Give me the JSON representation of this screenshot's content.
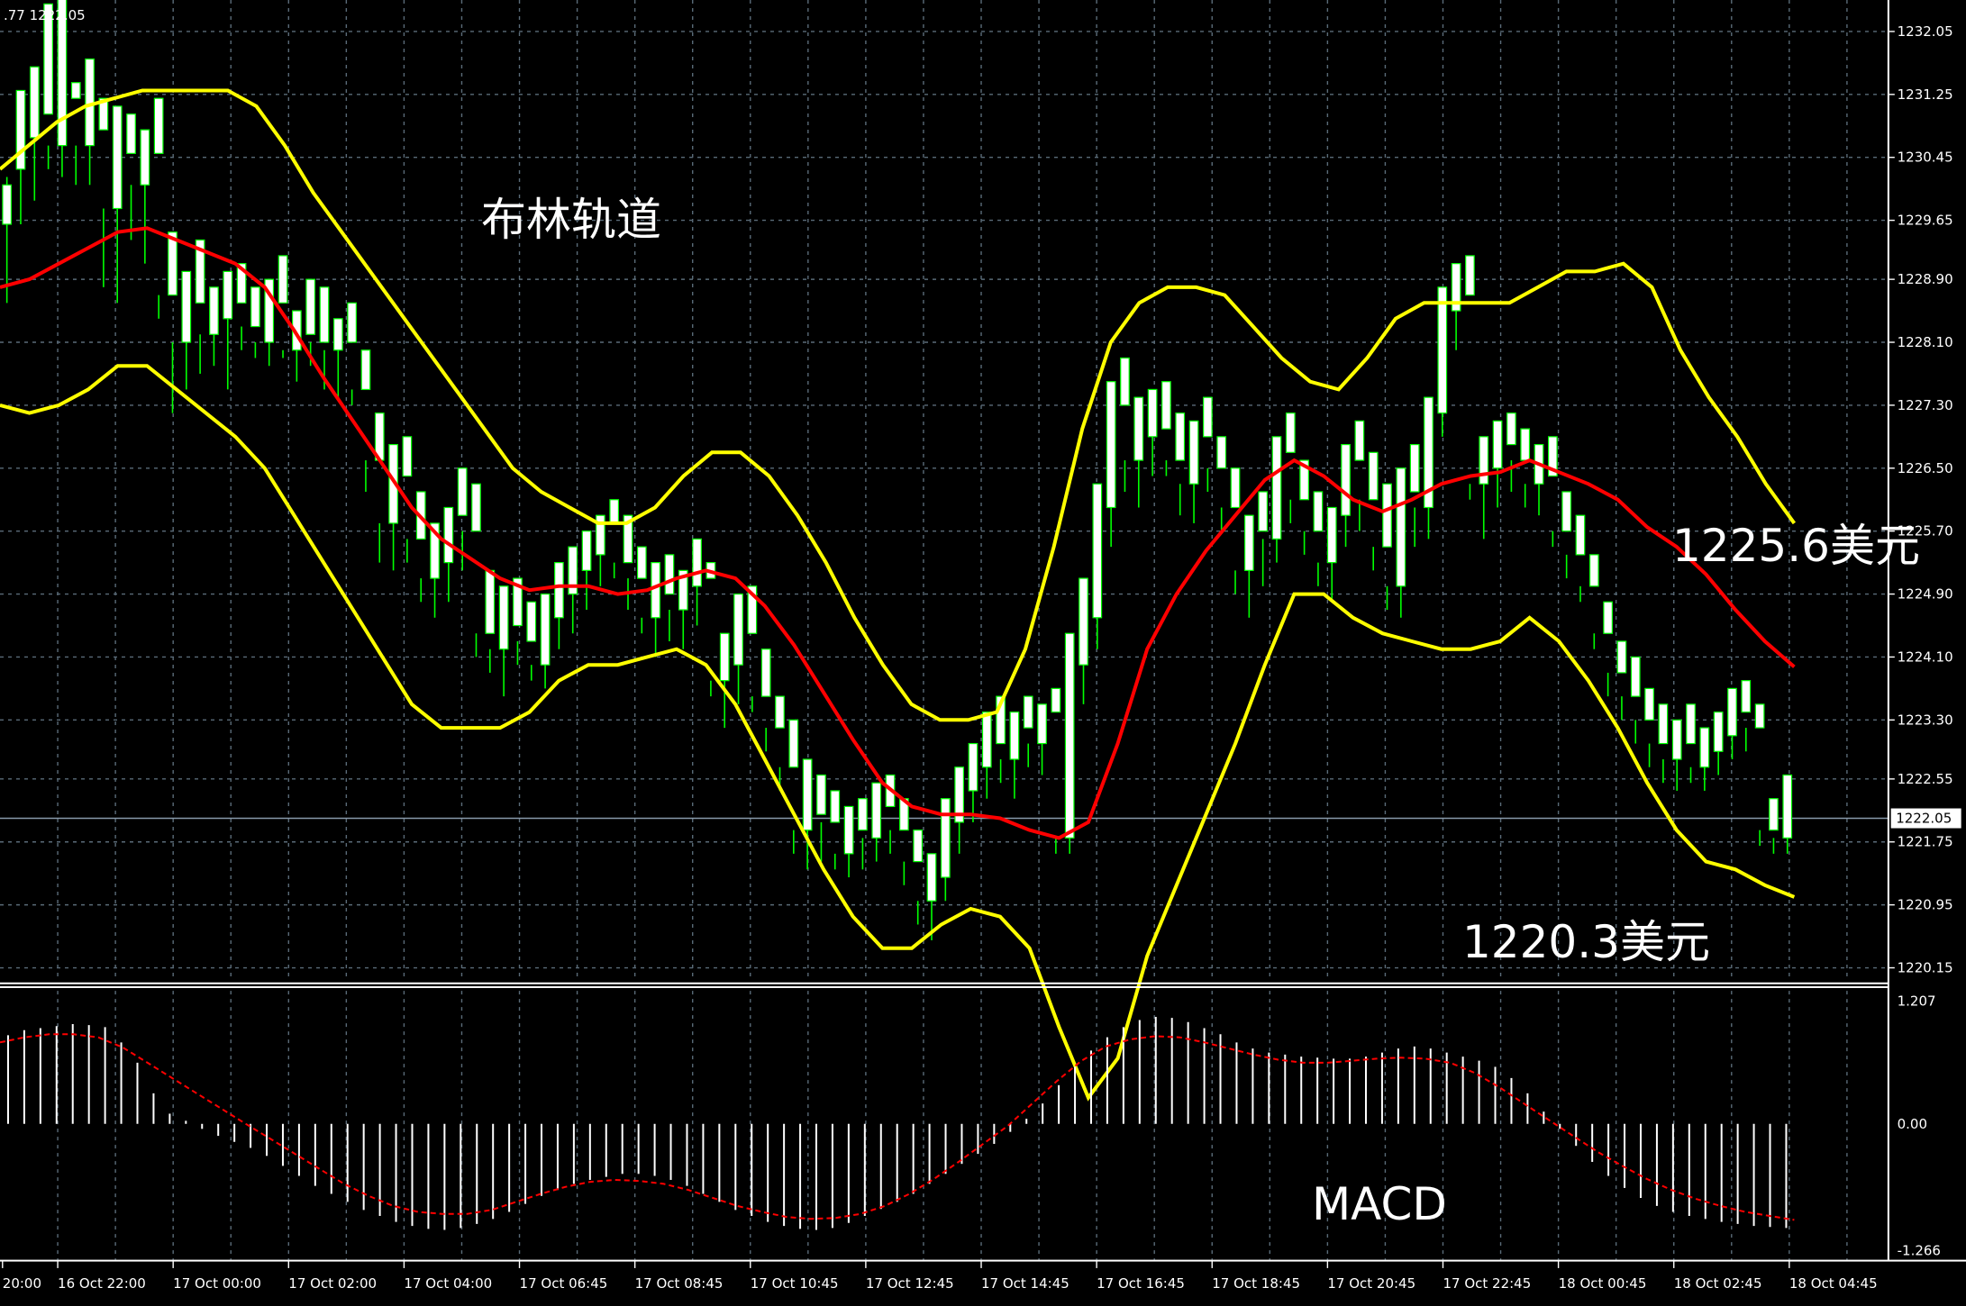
{
  "header": {
    "text": ".77 1222.05"
  },
  "price_axis": {
    "ticks": [
      "1232.05",
      "1231.25",
      "1230.45",
      "1229.65",
      "1228.90",
      "1228.10",
      "1227.30",
      "1226.50",
      "1225.70",
      "1224.90",
      "1224.10",
      "1223.30",
      "1222.55",
      "1221.75",
      "1220.95",
      "1220.15"
    ],
    "current_label": "1222.05",
    "current_value": 1222.05
  },
  "macd_axis": {
    "ticks": [
      "1.207",
      "0.00",
      "-1.266"
    ]
  },
  "time_axis": {
    "labels": [
      "20:00",
      "16 Oct 22:00",
      "17 Oct 00:00",
      "17 Oct 02:00",
      "17 Oct 04:00",
      "17 Oct 06:45",
      "17 Oct 08:45",
      "17 Oct 10:45",
      "17 Oct 12:45",
      "17 Oct 14:45",
      "17 Oct 16:45",
      "17 Oct 18:45",
      "17 Oct 20:45",
      "17 Oct 22:45",
      "18 Oct 00:45",
      "18 Oct 02:45",
      "18 Oct 04:45"
    ]
  },
  "annotations": {
    "bollinger": "布林轨道",
    "upper_target": "1225.6美元",
    "lower_target": "1220.3美元",
    "macd": "MACD"
  },
  "colors": {
    "background": "#000000",
    "grid": "#5a6b78",
    "bull_candle": "#ffffff",
    "bear_candle": "#000000",
    "wick": "#00ff00",
    "bollinger_band": "#ffff00",
    "moving_average": "#ff0000",
    "macd_hist": "#ffffff",
    "macd_signal": "#ff0000",
    "current_line": "#8899aa"
  },
  "chart_data": [
    {
      "type": "candlestick",
      "instrument": "XAUUSD",
      "ylim": [
        1220.0,
        1232.45
      ],
      "grid": true,
      "candles": [
        [
          1229.6,
          1230.1,
          1228.6,
          1230.2
        ],
        [
          1230.3,
          1231.3,
          1229.6,
          1230.7
        ],
        [
          1230.7,
          1231.6,
          1229.9,
          1231.0
        ],
        [
          1231.0,
          1232.4,
          1230.3,
          1230.6
        ],
        [
          1230.6,
          1232.5,
          1230.2,
          1231.2
        ],
        [
          1231.2,
          1231.4,
          1230.1,
          1230.6
        ],
        [
          1230.6,
          1231.7,
          1230.1,
          1230.8
        ],
        [
          1230.8,
          1231.2,
          1228.8,
          1229.8
        ],
        [
          1229.8,
          1231.1,
          1228.6,
          1230.5
        ],
        [
          1230.5,
          1231.0,
          1229.4,
          1230.1
        ],
        [
          1230.1,
          1230.8,
          1229.1,
          1230.5
        ],
        [
          1230.5,
          1231.2,
          1228.4,
          1228.7
        ],
        [
          1228.7,
          1229.5,
          1227.2,
          1228.1
        ],
        [
          1228.1,
          1229.0,
          1227.5,
          1228.6
        ],
        [
          1228.6,
          1229.4,
          1227.7,
          1228.2
        ],
        [
          1228.2,
          1228.8,
          1227.8,
          1228.4
        ],
        [
          1228.4,
          1229.0,
          1227.5,
          1228.6
        ],
        [
          1228.6,
          1229.1,
          1228.0,
          1228.3
        ],
        [
          1228.3,
          1228.8,
          1227.9,
          1228.1
        ],
        [
          1228.1,
          1228.9,
          1227.8,
          1228.6
        ],
        [
          1228.6,
          1229.2,
          1227.9,
          1228.0
        ],
        [
          1228.0,
          1228.5,
          1227.6,
          1228.2
        ],
        [
          1228.2,
          1228.9,
          1227.8,
          1228.1
        ],
        [
          1228.1,
          1228.8,
          1227.5,
          1228.0
        ],
        [
          1228.0,
          1228.4,
          1227.4,
          1228.1
        ],
        [
          1228.1,
          1228.6,
          1227.3,
          1227.5
        ],
        [
          1227.5,
          1228.0,
          1226.2,
          1226.6
        ],
        [
          1226.6,
          1227.2,
          1225.3,
          1225.8
        ],
        [
          1225.8,
          1226.8,
          1225.2,
          1226.4
        ],
        [
          1226.4,
          1226.9,
          1225.3,
          1225.6
        ],
        [
          1225.6,
          1226.2,
          1224.8,
          1225.1
        ],
        [
          1225.1,
          1225.8,
          1224.6,
          1225.3
        ],
        [
          1225.3,
          1226.0,
          1224.8,
          1225.9
        ],
        [
          1225.9,
          1226.5,
          1225.2,
          1225.7
        ],
        [
          1225.7,
          1226.3,
          1224.1,
          1224.4
        ],
        [
          1224.4,
          1225.2,
          1223.9,
          1224.2
        ],
        [
          1224.2,
          1225.0,
          1223.6,
          1224.5
        ],
        [
          1224.5,
          1225.1,
          1224.0,
          1224.3
        ],
        [
          1224.3,
          1224.8,
          1223.8,
          1224.0
        ],
        [
          1224.0,
          1224.9,
          1223.7,
          1224.6
        ],
        [
          1224.6,
          1225.3,
          1224.2,
          1224.9
        ],
        [
          1224.9,
          1225.5,
          1224.4,
          1225.2
        ],
        [
          1225.2,
          1225.7,
          1224.7,
          1225.4
        ],
        [
          1225.4,
          1225.9,
          1225.0,
          1225.8
        ],
        [
          1225.8,
          1226.1,
          1225.1,
          1225.3
        ],
        [
          1225.3,
          1225.9,
          1224.7,
          1225.1
        ],
        [
          1225.1,
          1225.5,
          1224.4,
          1224.6
        ],
        [
          1224.6,
          1225.3,
          1224.1,
          1224.9
        ],
        [
          1224.9,
          1225.4,
          1224.3,
          1224.7
        ],
        [
          1224.7,
          1225.2,
          1224.2,
          1225.0
        ],
        [
          1225.0,
          1225.6,
          1224.5,
          1225.1
        ],
        [
          1225.1,
          1225.3,
          1223.6,
          1223.8
        ],
        [
          1223.8,
          1224.4,
          1223.2,
          1224.0
        ],
        [
          1224.0,
          1224.9,
          1223.5,
          1224.4
        ],
        [
          1224.4,
          1225.0,
          1223.4,
          1223.6
        ],
        [
          1223.6,
          1224.2,
          1222.9,
          1223.2
        ],
        [
          1223.2,
          1223.6,
          1222.4,
          1222.7
        ],
        [
          1222.7,
          1223.3,
          1221.6,
          1221.9
        ],
        [
          1221.9,
          1222.8,
          1221.4,
          1222.1
        ],
        [
          1222.1,
          1222.6,
          1221.5,
          1222.0
        ],
        [
          1222.0,
          1222.4,
          1221.4,
          1221.6
        ],
        [
          1221.6,
          1222.2,
          1221.3,
          1221.9
        ],
        [
          1221.9,
          1222.3,
          1221.4,
          1221.8
        ],
        [
          1221.8,
          1222.5,
          1221.5,
          1222.2
        ],
        [
          1222.2,
          1222.6,
          1221.6,
          1221.9
        ],
        [
          1221.9,
          1222.3,
          1221.2,
          1221.5
        ],
        [
          1221.5,
          1221.9,
          1220.7,
          1221.0
        ],
        [
          1221.0,
          1221.6,
          1220.5,
          1221.3
        ],
        [
          1221.3,
          1222.3,
          1221.0,
          1222.0
        ],
        [
          1222.0,
          1222.7,
          1221.6,
          1222.4
        ],
        [
          1222.4,
          1223.0,
          1222.0,
          1222.7
        ],
        [
          1222.7,
          1223.4,
          1222.3,
          1223.0
        ],
        [
          1223.0,
          1223.6,
          1222.5,
          1222.8
        ],
        [
          1222.8,
          1223.4,
          1222.3,
          1223.2
        ],
        [
          1223.2,
          1223.6,
          1222.7,
          1223.0
        ],
        [
          1223.0,
          1223.5,
          1222.6,
          1223.4
        ],
        [
          1223.4,
          1223.7,
          1221.6,
          1221.8
        ],
        [
          1221.8,
          1224.4,
          1221.6,
          1224.0
        ],
        [
          1224.0,
          1225.1,
          1223.5,
          1224.6
        ],
        [
          1224.6,
          1226.3,
          1224.2,
          1226.0
        ],
        [
          1226.0,
          1227.6,
          1225.5,
          1227.3
        ],
        [
          1227.3,
          1227.9,
          1226.2,
          1226.6
        ],
        [
          1226.6,
          1227.4,
          1226.0,
          1226.9
        ],
        [
          1226.9,
          1227.5,
          1226.4,
          1227.0
        ],
        [
          1227.0,
          1227.6,
          1226.4,
          1226.6
        ],
        [
          1226.6,
          1227.2,
          1225.9,
          1226.3
        ],
        [
          1226.3,
          1227.1,
          1225.8,
          1226.9
        ],
        [
          1226.9,
          1227.4,
          1226.2,
          1226.5
        ],
        [
          1226.5,
          1226.9,
          1225.7,
          1226.0
        ],
        [
          1226.0,
          1226.5,
          1224.9,
          1225.2
        ],
        [
          1225.2,
          1225.9,
          1224.6,
          1225.7
        ],
        [
          1225.7,
          1226.2,
          1225.0,
          1225.6
        ],
        [
          1225.6,
          1226.9,
          1225.3,
          1226.7
        ],
        [
          1226.7,
          1227.2,
          1225.8,
          1226.1
        ],
        [
          1226.1,
          1226.6,
          1225.4,
          1225.7
        ],
        [
          1225.7,
          1226.2,
          1225.0,
          1225.3
        ],
        [
          1225.3,
          1226.0,
          1224.8,
          1225.9
        ],
        [
          1225.9,
          1226.8,
          1225.5,
          1226.6
        ],
        [
          1226.6,
          1227.1,
          1225.7,
          1226.1
        ],
        [
          1226.1,
          1226.7,
          1225.2,
          1225.5
        ],
        [
          1225.5,
          1226.3,
          1224.7,
          1225.0
        ],
        [
          1225.0,
          1226.5,
          1224.6,
          1226.2
        ],
        [
          1226.2,
          1226.8,
          1225.5,
          1226.0
        ],
        [
          1226.0,
          1227.4,
          1225.6,
          1227.2
        ],
        [
          1227.2,
          1228.8,
          1226.9,
          1228.5
        ],
        [
          1228.5,
          1229.1,
          1228.0,
          1228.7
        ],
        [
          1228.7,
          1229.2,
          1226.1,
          1226.3
        ],
        [
          1226.3,
          1226.9,
          1225.6,
          1226.5
        ],
        [
          1226.5,
          1227.1,
          1226.0,
          1226.8
        ],
        [
          1226.8,
          1227.2,
          1226.2,
          1226.6
        ],
        [
          1226.6,
          1227.0,
          1226.0,
          1226.3
        ],
        [
          1226.3,
          1226.8,
          1225.9,
          1226.4
        ],
        [
          1226.4,
          1226.9,
          1225.5,
          1225.7
        ],
        [
          1225.7,
          1226.2,
          1225.1,
          1225.4
        ],
        [
          1225.4,
          1225.9,
          1224.8,
          1225.0
        ],
        [
          1225.0,
          1225.4,
          1224.2,
          1224.4
        ],
        [
          1224.4,
          1224.8,
          1223.6,
          1223.9
        ],
        [
          1223.9,
          1224.3,
          1223.3,
          1223.6
        ],
        [
          1223.6,
          1224.1,
          1223.0,
          1223.3
        ],
        [
          1223.3,
          1223.7,
          1222.7,
          1223.0
        ],
        [
          1223.0,
          1223.5,
          1222.5,
          1222.8
        ],
        [
          1222.8,
          1223.3,
          1222.4,
          1223.0
        ],
        [
          1223.0,
          1223.5,
          1222.5,
          1222.7
        ],
        [
          1222.7,
          1223.2,
          1222.4,
          1222.9
        ],
        [
          1222.9,
          1223.4,
          1222.6,
          1223.1
        ],
        [
          1223.1,
          1223.7,
          1222.8,
          1223.4
        ],
        [
          1223.4,
          1223.8,
          1222.9,
          1223.2
        ],
        [
          1223.2,
          1223.5,
          1221.7,
          1221.9
        ],
        [
          1221.9,
          1222.3,
          1221.6,
          1221.8
        ],
        [
          1221.8,
          1222.6,
          1221.6,
          1222.05
        ]
      ],
      "bollinger_upper": [
        1230.3,
        1230.6,
        1230.9,
        1231.1,
        1231.2,
        1231.3,
        1231.3,
        1231.3,
        1231.3,
        1231.1,
        1230.6,
        1230.0,
        1229.5,
        1229.0,
        1228.5,
        1228.0,
        1227.5,
        1227.0,
        1226.5,
        1226.2,
        1226.0,
        1225.8,
        1225.8,
        1226.0,
        1226.4,
        1226.7,
        1226.7,
        1226.4,
        1225.9,
        1225.3,
        1224.6,
        1224.0,
        1223.5,
        1223.3,
        1223.3,
        1223.4,
        1224.2,
        1225.5,
        1227.0,
        1228.1,
        1228.6,
        1228.8,
        1228.8,
        1228.7,
        1228.3,
        1227.9,
        1227.6,
        1227.5,
        1227.9,
        1228.4,
        1228.6,
        1228.6,
        1228.6,
        1228.6,
        1228.8,
        1229.0,
        1229.0,
        1229.1,
        1228.8,
        1228.0,
        1227.4,
        1226.9,
        1226.3,
        1225.8
      ],
      "bollinger_lower": [
        1227.3,
        1227.2,
        1227.3,
        1227.5,
        1227.8,
        1227.8,
        1227.5,
        1227.2,
        1226.9,
        1226.5,
        1225.9,
        1225.3,
        1224.7,
        1224.1,
        1223.5,
        1223.2,
        1223.2,
        1223.2,
        1223.4,
        1223.8,
        1224.0,
        1224.0,
        1224.1,
        1224.2,
        1224.0,
        1223.5,
        1222.8,
        1222.1,
        1221.4,
        1220.8,
        1220.4,
        1220.4,
        1220.7,
        1220.9,
        1220.8,
        1220.4,
        1219.4,
        1218.5,
        1219.0,
        1220.3,
        1221.2,
        1222.1,
        1223.0,
        1224.0,
        1224.9,
        1224.9,
        1224.6,
        1224.4,
        1224.3,
        1224.2,
        1224.2,
        1224.3,
        1224.6,
        1224.3,
        1223.8,
        1223.2,
        1222.5,
        1221.9,
        1221.5,
        1221.4,
        1221.2,
        1221.05
      ]
    },
    {
      "type": "macd",
      "ylim": [
        -1.266,
        1.207
      ],
      "histogram": [
        0.87,
        0.92,
        0.94,
        0.96,
        0.98,
        0.97,
        0.95,
        0.8,
        0.6,
        0.3,
        0.1,
        0.03,
        -0.05,
        -0.12,
        -0.18,
        -0.24,
        -0.32,
        -0.42,
        -0.52,
        -0.62,
        -0.7,
        -0.78,
        -0.86,
        -0.92,
        -0.98,
        -1.02,
        -1.05,
        -1.06,
        -1.04,
        -1.0,
        -0.95,
        -0.88,
        -0.8,
        -0.72,
        -0.66,
        -0.6,
        -0.56,
        -0.53,
        -0.5,
        -0.5,
        -0.52,
        -0.56,
        -0.62,
        -0.7,
        -0.78,
        -0.86,
        -0.92,
        -0.98,
        -1.02,
        -1.05,
        -1.06,
        -1.04,
        -0.99,
        -0.92,
        -0.85,
        -0.78,
        -0.7,
        -0.6,
        -0.5,
        -0.4,
        -0.3,
        -0.2,
        -0.08,
        0.05,
        0.2,
        0.38,
        0.56,
        0.72,
        0.85,
        0.95,
        1.02,
        1.05,
        1.04,
        1.0,
        0.94,
        0.88,
        0.8,
        0.74,
        0.7,
        0.68,
        0.66,
        0.65,
        0.64,
        0.64,
        0.66,
        0.7,
        0.74,
        0.76,
        0.74,
        0.7,
        0.66,
        0.62,
        0.56,
        0.45,
        0.3,
        0.12,
        -0.05,
        -0.22,
        -0.38,
        -0.52,
        -0.64,
        -0.74,
        -0.82,
        -0.88,
        -0.92,
        -0.95,
        -0.98,
        -1.0,
        -1.02,
        -1.03,
        -1.04
      ],
      "signal": [
        0.8,
        0.85,
        0.88,
        0.88,
        0.85,
        0.75,
        0.6,
        0.45,
        0.3,
        0.15,
        0.0,
        -0.15,
        -0.3,
        -0.45,
        -0.6,
        -0.72,
        -0.82,
        -0.88,
        -0.9,
        -0.9,
        -0.86,
        -0.78,
        -0.7,
        -0.63,
        -0.58,
        -0.56,
        -0.57,
        -0.6,
        -0.66,
        -0.74,
        -0.82,
        -0.88,
        -0.93,
        -0.95,
        -0.94,
        -0.9,
        -0.82,
        -0.7,
        -0.55,
        -0.38,
        -0.2,
        -0.02,
        0.2,
        0.42,
        0.62,
        0.76,
        0.83,
        0.86,
        0.85,
        0.8,
        0.74,
        0.68,
        0.63,
        0.6,
        0.6,
        0.62,
        0.64,
        0.65,
        0.64,
        0.6,
        0.5,
        0.36,
        0.2,
        0.04,
        -0.12,
        -0.28,
        -0.42,
        -0.55,
        -0.66,
        -0.75,
        -0.82,
        -0.88,
        -0.92,
        -0.96
      ]
    }
  ]
}
